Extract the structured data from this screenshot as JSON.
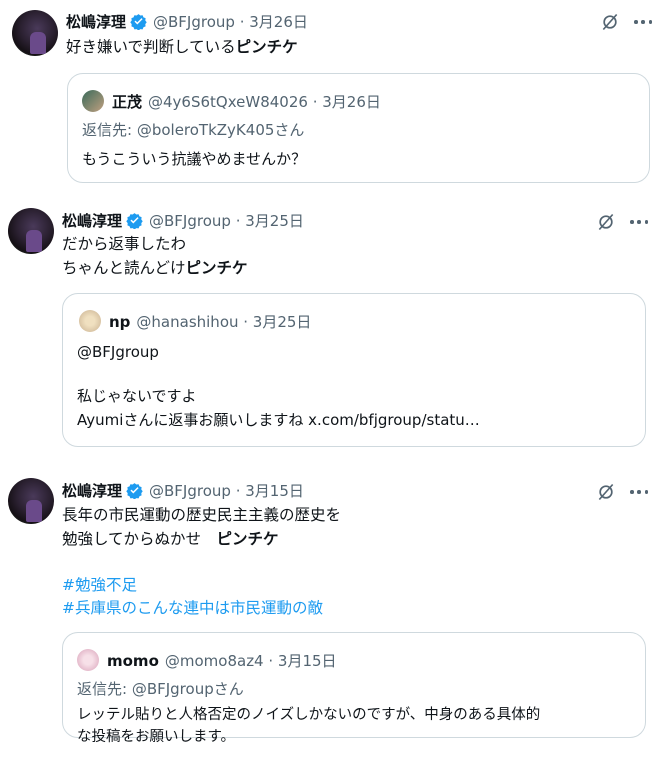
{
  "tweets": [
    {
      "author": "松嶋淳理",
      "meta": "@BFJgroup · 3月26日",
      "lines": [
        {
          "prefix": "好き嫌いで判断している",
          "bold": "ピンチケ"
        }
      ],
      "quote": {
        "author": "正茂",
        "meta": "@4y6S6tQxeW84026 · 3月26日",
        "reply_to": "返信先: @boleroTkZyK405さん",
        "lines": [
          "もうこういう抗議やめませんか？"
        ]
      }
    },
    {
      "author": "松嶋淳理",
      "meta": "@BFJgroup · 3月25日",
      "line1": "だから返事したわ",
      "line2_prefix": "ちゃんと読んどけ",
      "line2_bold": "ピンチケ",
      "quote": {
        "author": "np",
        "meta": "@hanashihou · 3月25日",
        "lines": [
          "@BFJgroup",
          "",
          "私じゃないですよ",
          "Ayumiさんに返事お願いしますね x.com/bfjgroup/statu…"
        ]
      }
    },
    {
      "author": "松嶋淳理",
      "meta": "@BFJgroup · 3月15日",
      "line1": "長年の市民運動の歴史民主主義の歴史を",
      "line2_prefix": "勉強してからぬかせ　",
      "line2_bold": "ピンチケ",
      "hashtags": [
        "#勉強不足",
        "#兵庫県のこんな連中は市民運動の敵"
      ],
      "quote": {
        "author": "momo",
        "meta": "@momo8az4 · 3月15日",
        "reply_to": "返信先: @BFJgroupさん",
        "lines": [
          "レッテル貼りと人格否定のノイズしかないのですが、中身のある具体的",
          "な投稿をお願いします。"
        ]
      }
    }
  ],
  "icons": {
    "verified": "verified-badge-icon",
    "grok": "grok-icon",
    "more": "more-icon"
  },
  "colors": {
    "link": "#1d9bf0",
    "muted": "#536471",
    "verified": "#1d9bf0",
    "border": "#cfd9de"
  }
}
